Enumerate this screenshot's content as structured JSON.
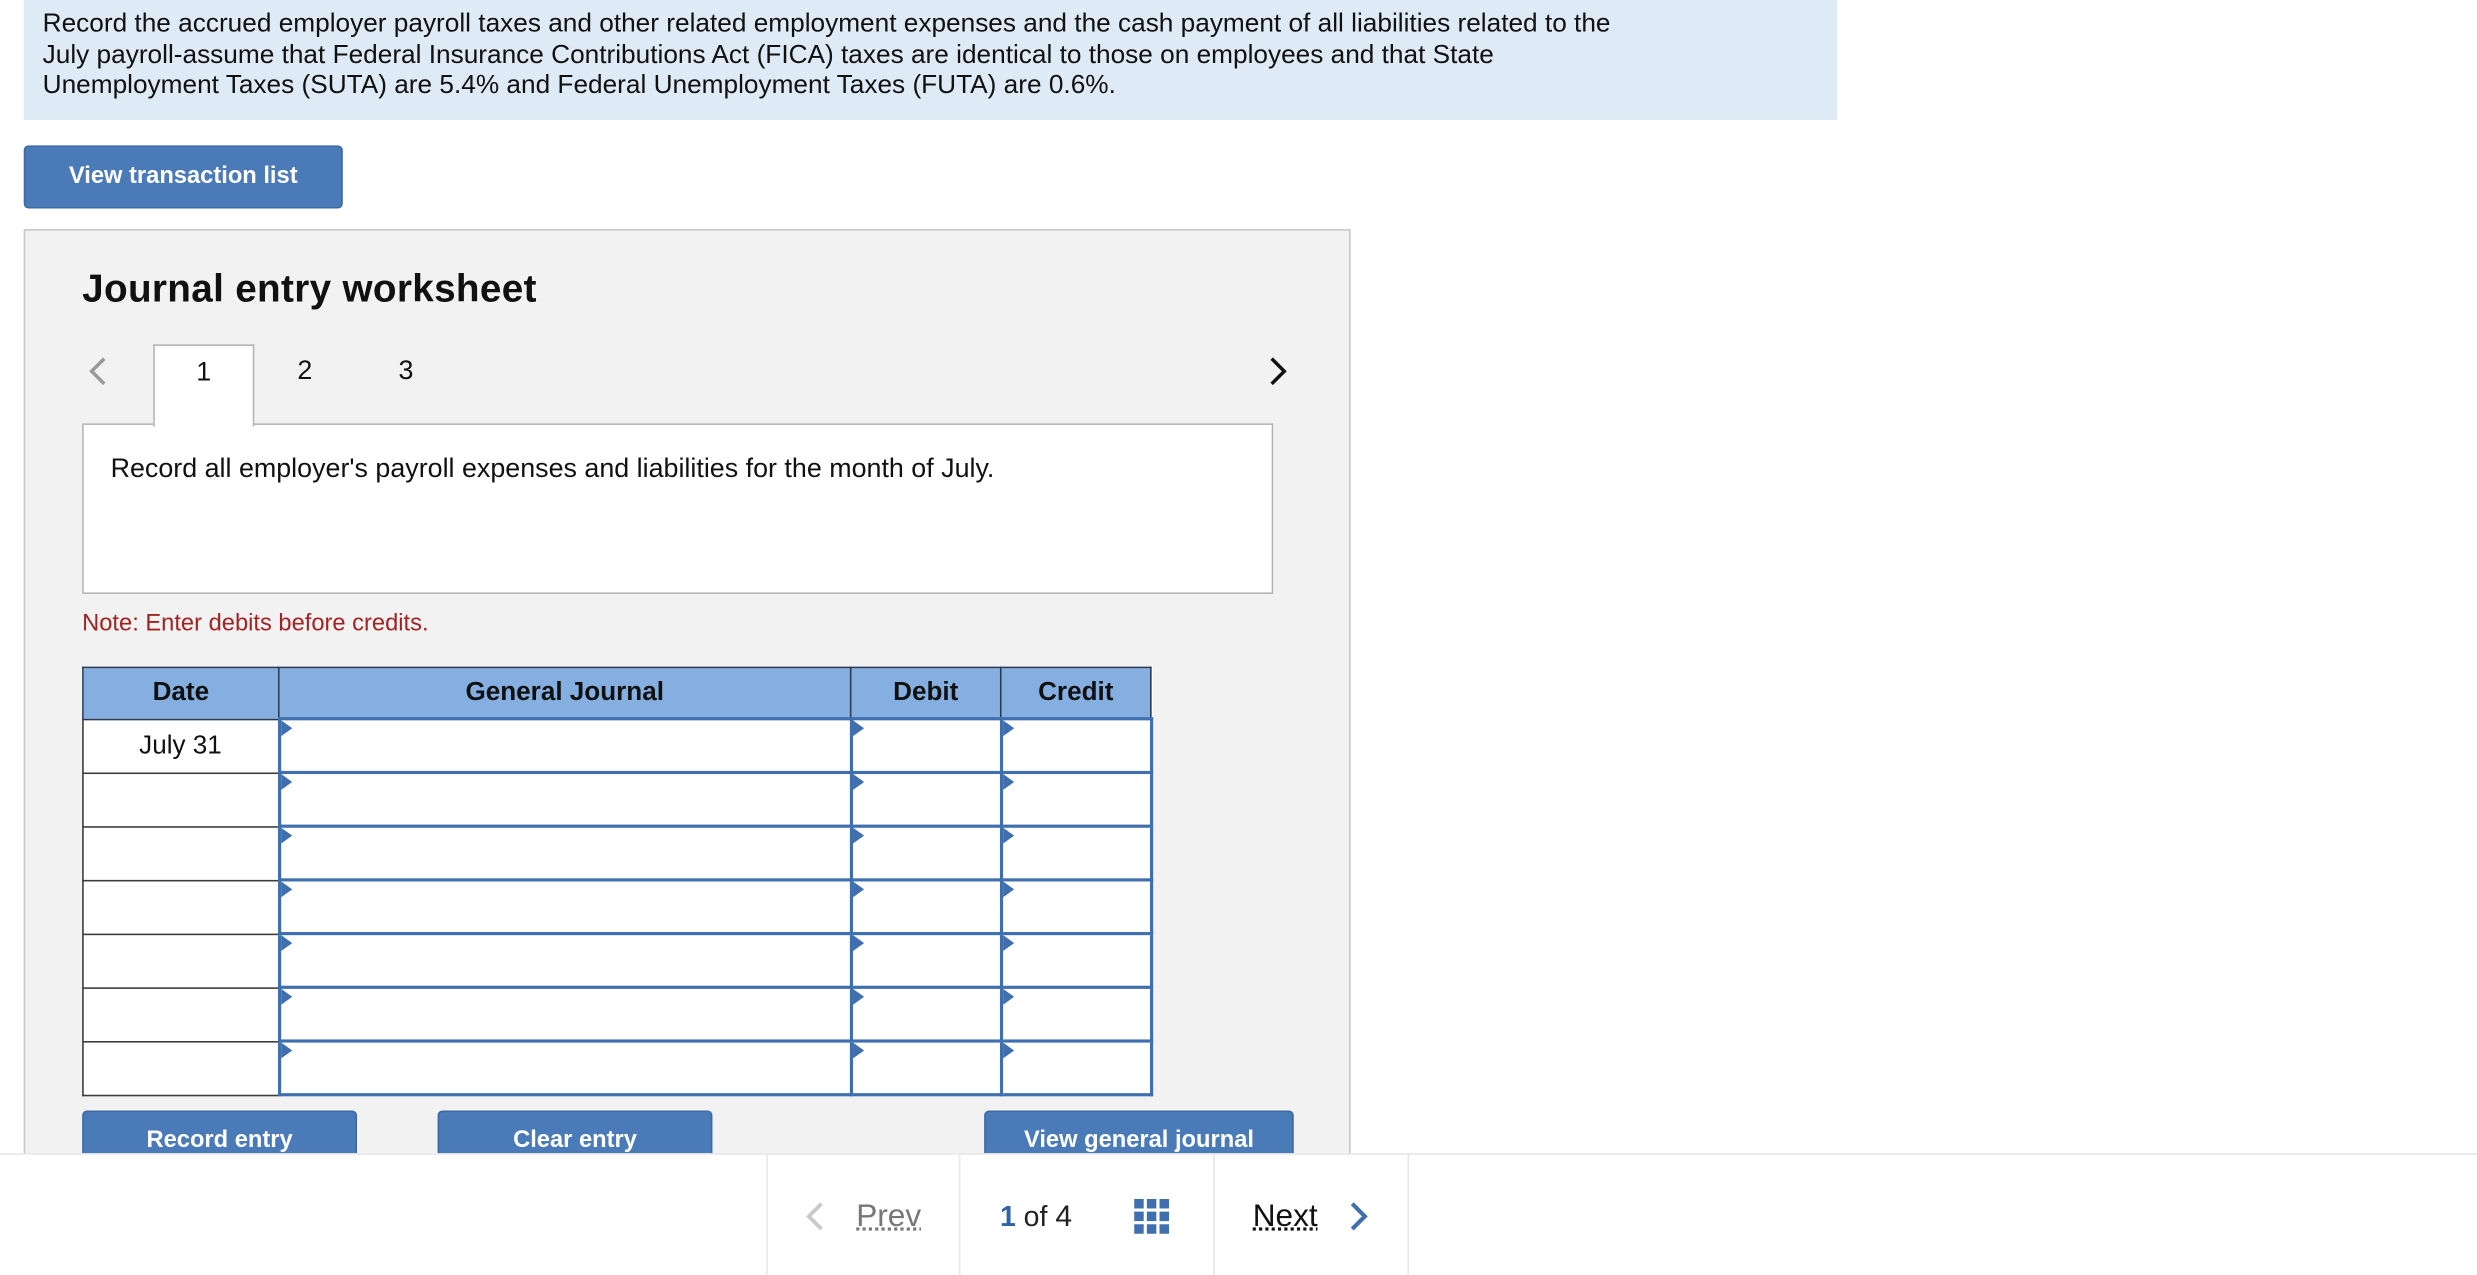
{
  "question": {
    "line1": "Record the accrued employer payroll taxes and other related employment expenses and the cash payment of all liabilities related to the",
    "line2": "July payroll-assume that Federal Insurance Contributions Act (FICA) taxes are identical to those on employees and that State",
    "line3": "Unemployment Taxes (SUTA) are 5.4% and Federal Unemployment Taxes (FUTA) are 0.6%."
  },
  "view_transaction_list": "View transaction list",
  "worksheet": {
    "title": "Journal entry worksheet",
    "tabs": [
      "1",
      "2",
      "3"
    ],
    "active_tab": "1",
    "instruction": "Record all employer's payroll expenses and liabilities for the month of July.",
    "note": "Note: Enter debits before credits.",
    "table": {
      "headers": [
        "Date",
        "General Journal",
        "Debit",
        "Credit"
      ],
      "rows": [
        {
          "date": "July 31",
          "account": "",
          "debit": "",
          "credit": ""
        },
        {
          "date": "",
          "account": "",
          "debit": "",
          "credit": ""
        },
        {
          "date": "",
          "account": "",
          "debit": "",
          "credit": ""
        },
        {
          "date": "",
          "account": "",
          "debit": "",
          "credit": ""
        },
        {
          "date": "",
          "account": "",
          "debit": "",
          "credit": ""
        },
        {
          "date": "",
          "account": "",
          "debit": "",
          "credit": ""
        },
        {
          "date": "",
          "account": "",
          "debit": "",
          "credit": ""
        }
      ]
    },
    "buttons": {
      "record": "Record entry",
      "clear": "Clear entry",
      "view_journal": "View general journal"
    }
  },
  "pager": {
    "prev": "Prev",
    "current": "1",
    "of": "of",
    "total": "4",
    "next": "Next"
  },
  "colors": {
    "accent": "#4a7ab8",
    "question_bg": "#deeaf6",
    "table_header": "#85afe1",
    "note": "#a12323"
  }
}
